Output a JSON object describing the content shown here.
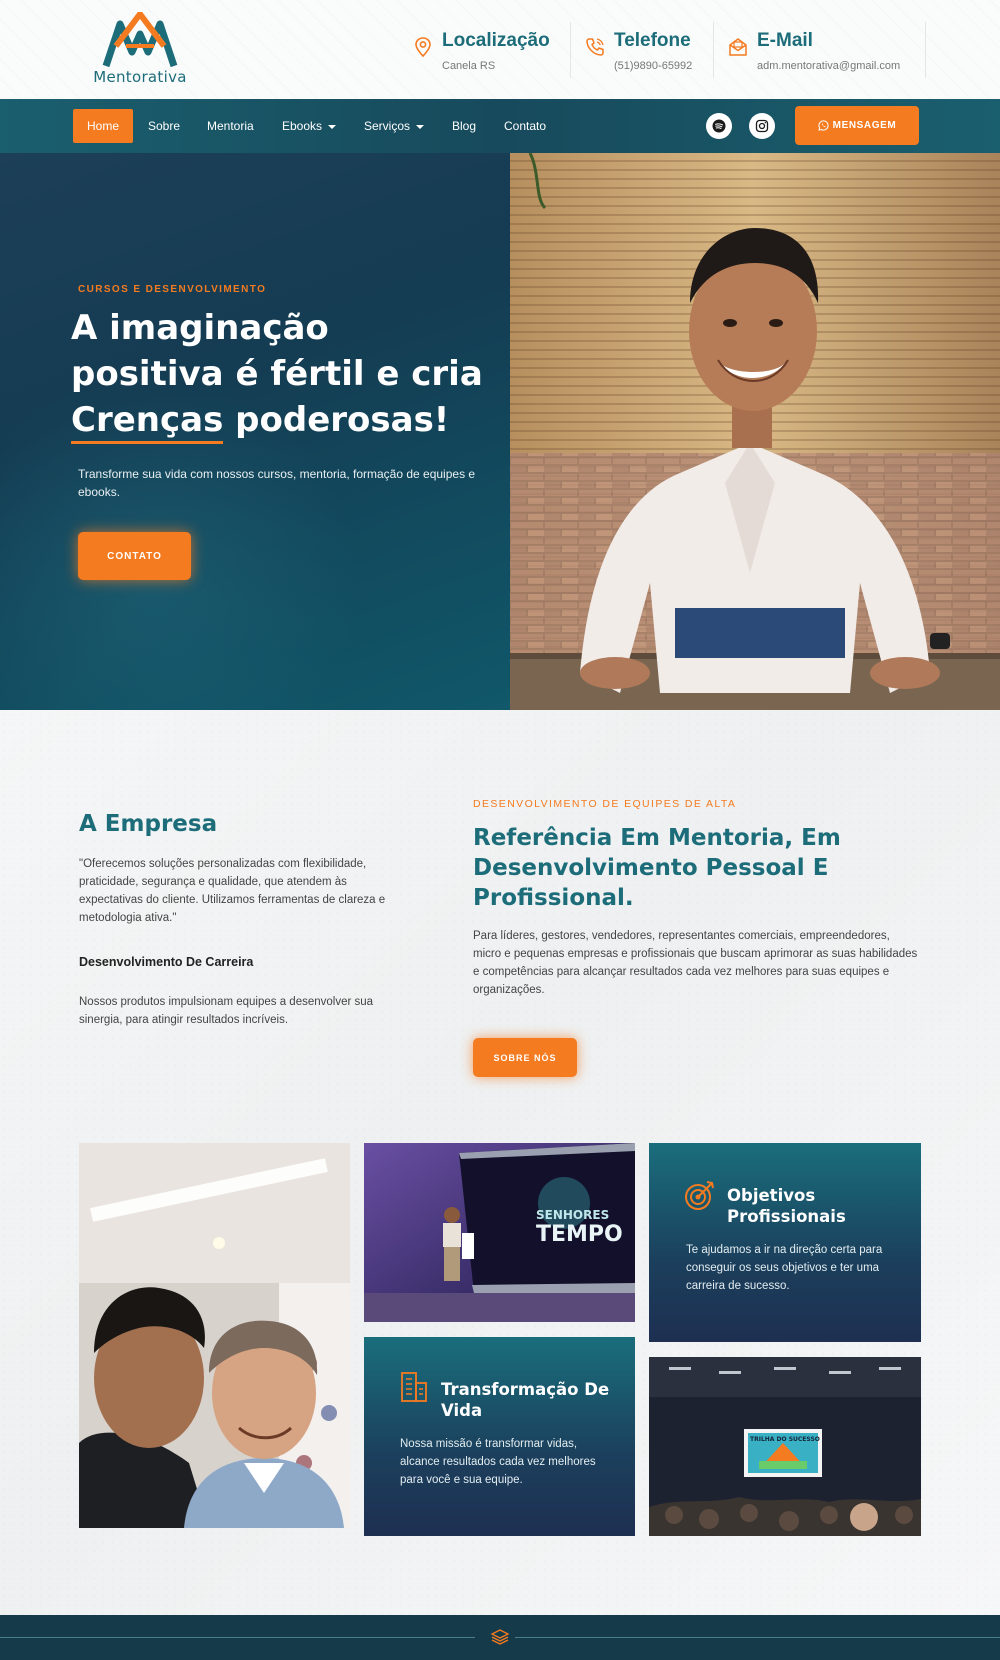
{
  "brand": {
    "name": "Mentorativa",
    "orange": "#f47b20",
    "teal": "#1c6d79",
    "navy": "#143c52"
  },
  "header": {
    "location": {
      "title": "Localização",
      "value": "Canela RS",
      "icon": "location-pin-icon"
    },
    "phone": {
      "title": "Telefone",
      "value": "(51)9890-65992",
      "icon": "phone-icon"
    },
    "email": {
      "title": "E-Mail",
      "value": "adm.mentorativa@gmail.com",
      "icon": "mail-icon"
    }
  },
  "nav": {
    "items": [
      {
        "label": "Home",
        "active": true
      },
      {
        "label": "Sobre"
      },
      {
        "label": "Mentoria"
      },
      {
        "label": "Ebooks",
        "dropdown": true
      },
      {
        "label": "Serviços",
        "dropdown": true
      },
      {
        "label": "Blog"
      },
      {
        "label": "Contato"
      }
    ],
    "social": [
      "spotify-icon",
      "instagram-icon"
    ],
    "message_button": "MENSAGEM"
  },
  "hero": {
    "kicker": "CURSOS E DESENVOLVIMENTO",
    "title_line1": "A imaginação",
    "title_line2": "positiva é fértil e cria",
    "title_highlight": "Crenças",
    "title_end": " poderosas!",
    "subtitle": "Transforme sua vida com nossos cursos, mentoria, formação de equipes e ebooks.",
    "button": "CONTATO"
  },
  "about": {
    "title": "A Empresa",
    "quote": "\"Oferecemos soluções personalizadas com flexibilidade, praticidade, segurança e qualidade, que atendem às expectativas do cliente. Utilizamos ferramentas de clareza e metodologia ativa.\"",
    "subtitle": "Desenvolvimento De Carreira",
    "text": "Nossos produtos impulsionam equipes a desenvolver sua sinergia, para atingir resultados incríveis."
  },
  "reference": {
    "kicker": "DESENVOLVIMENTO DE EQUIPES DE ALTA",
    "title": "Referência Em Mentoria, Em Desenvolvimento Pessoal E Profissional.",
    "text": "Para líderes, gestores, vendedores, representantes comerciais, empreendedores, micro e pequenas empresas e profissionais que buscam aprimorar as suas habilidades e competências para alcançar resultados cada vez melhores para suas equipes e organizações.",
    "button": "SOBRE NÓS"
  },
  "cards": {
    "objetivos": {
      "title": "Objetivos Profissionais",
      "text": "Te ajudamos a ir na direção certa para conseguir os seus objetivos e ter uma carreira de sucesso.",
      "icon": "target-icon"
    },
    "transformacao": {
      "title": "Transformação De Vida",
      "text": "Nossa missão é transformar vidas, alcance resultados cada vez melhores para você e sua equipe.",
      "icon": "building-icon"
    }
  },
  "photos": {
    "stage_screen": "SENHORES DO TEMPO",
    "auditorium_screen": "TRILHA DO SUCESSO"
  }
}
